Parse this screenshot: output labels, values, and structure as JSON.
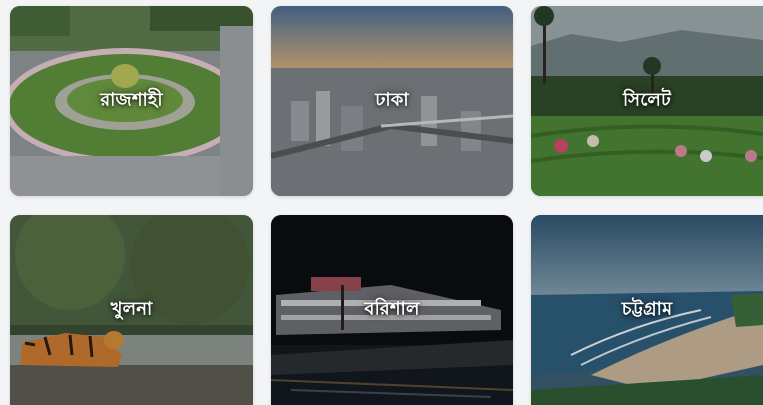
{
  "divisions": [
    {
      "name": "রাজশাহী"
    },
    {
      "name": "ঢাকা"
    },
    {
      "name": "সিলেট"
    },
    {
      "name": "খুলনা"
    },
    {
      "name": "বরিশাল"
    },
    {
      "name": "চট্টগ্রাম"
    }
  ]
}
